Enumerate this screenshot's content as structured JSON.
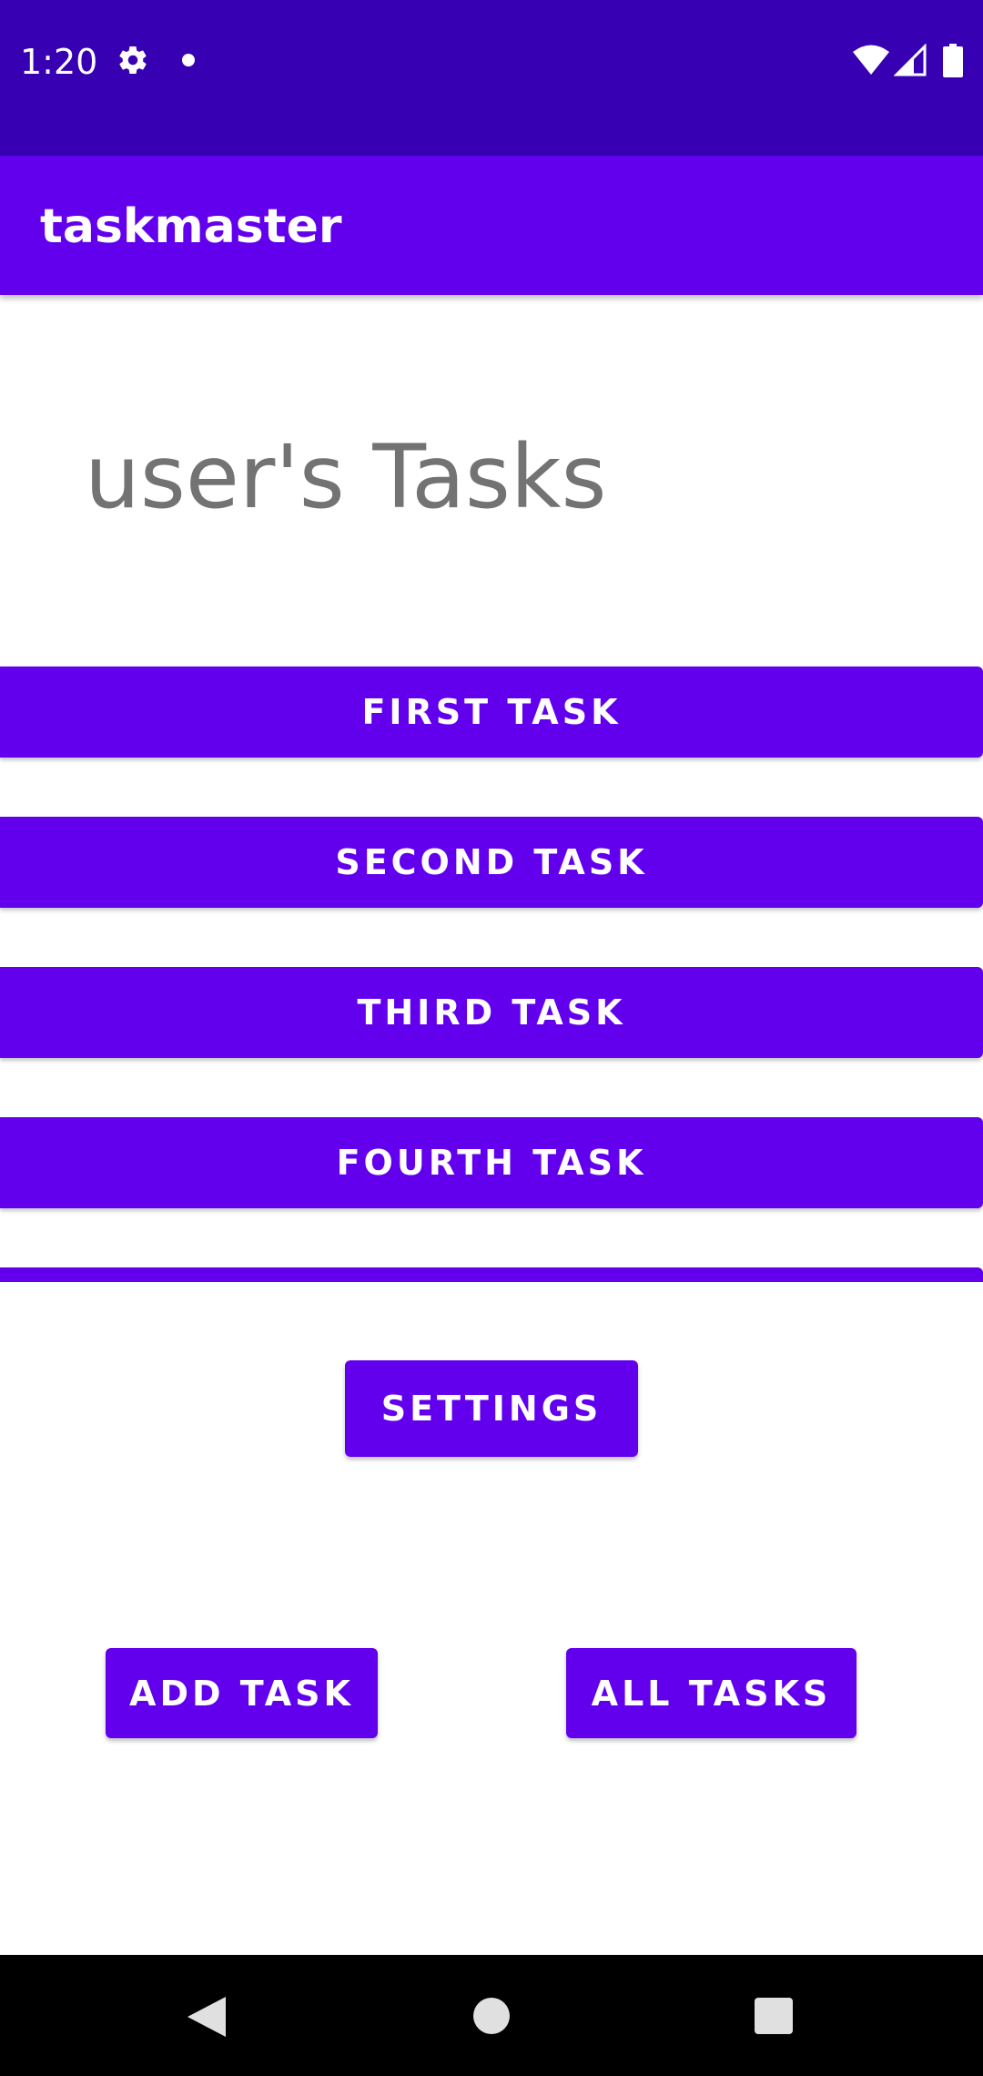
{
  "status_bar": {
    "time": "1:20",
    "icons": [
      "gear-icon",
      "notification-dot-icon",
      "wifi-icon",
      "cell-signal-icon",
      "battery-icon"
    ]
  },
  "app_bar": {
    "title": "taskmaster"
  },
  "header": {
    "title": "user's Tasks"
  },
  "tasks": [
    {
      "label": "FIRST TASK"
    },
    {
      "label": "SECOND TASK"
    },
    {
      "label": "THIRD TASK"
    },
    {
      "label": "FOURTH TASK"
    },
    {
      "label": ""
    }
  ],
  "buttons": {
    "settings": "SETTINGS",
    "add_task": "ADD TASK",
    "all_tasks": "ALL TASKS"
  },
  "nav_bar": {
    "icons": [
      "back-icon",
      "home-icon",
      "recents-icon"
    ]
  },
  "colors": {
    "status_bar": "#3700b3",
    "primary": "#6200ee",
    "title_text": "#737373",
    "nav_bar": "#000000"
  }
}
